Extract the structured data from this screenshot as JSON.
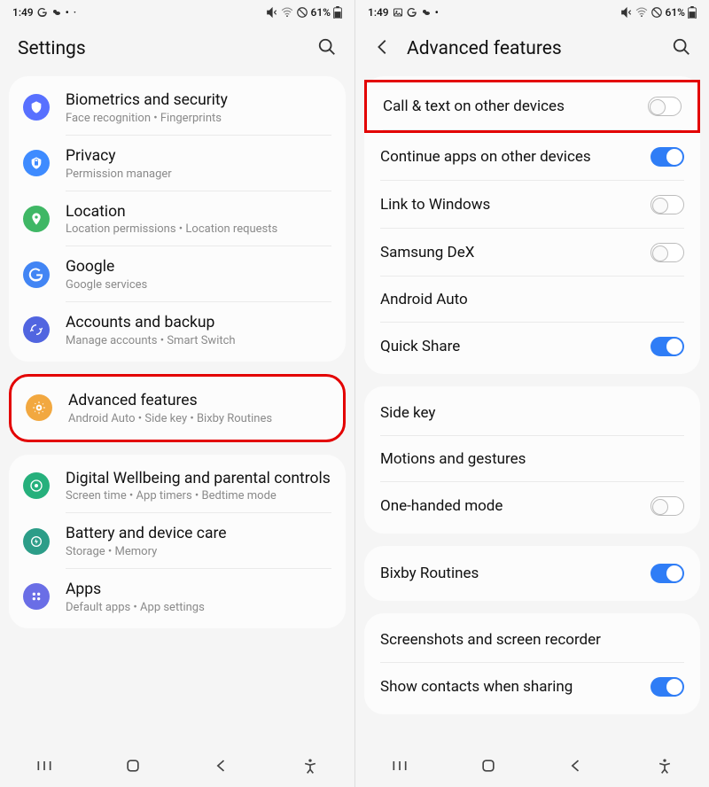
{
  "status": {
    "time": "1:49",
    "battery": "61%"
  },
  "left": {
    "title": "Settings",
    "groups": [
      [
        {
          "key": "biometrics",
          "title": "Biometrics and security",
          "sub": "Face recognition  •  Fingerprints",
          "iconClass": "ic-blue"
        },
        {
          "key": "privacy",
          "title": "Privacy",
          "sub": "Permission manager",
          "iconClass": "ic-lblue"
        },
        {
          "key": "location",
          "title": "Location",
          "sub": "Location permissions  •  Location requests",
          "iconClass": "ic-green"
        },
        {
          "key": "google",
          "title": "Google",
          "sub": "Google services",
          "iconClass": "ic-google"
        },
        {
          "key": "accounts",
          "title": "Accounts and backup",
          "sub": "Manage accounts  •  Smart Switch",
          "iconClass": "ic-dblue"
        }
      ],
      [
        {
          "key": "advanced",
          "title": "Advanced features",
          "sub": "Android Auto  •  Side key  •  Bixby Routines",
          "iconClass": "ic-orange",
          "highlighted": true
        }
      ],
      [
        {
          "key": "wellbeing",
          "title": "Digital Wellbeing and parental controls",
          "sub": "Screen time  •  App timers  •  Bedtime mode",
          "iconClass": "ic-teal"
        },
        {
          "key": "battery",
          "title": "Battery and device care",
          "sub": "Storage  •  Memory",
          "iconClass": "ic-teal2"
        },
        {
          "key": "apps",
          "title": "Apps",
          "sub": "Default apps  •  App settings",
          "iconClass": "ic-purple"
        }
      ]
    ]
  },
  "right": {
    "title": "Advanced features",
    "groups": [
      [
        {
          "key": "calltext",
          "title": "Call & text on other devices",
          "toggle": "off",
          "highlighted": true
        },
        {
          "key": "continueapps",
          "title": "Continue apps on other devices",
          "toggle": "on"
        },
        {
          "key": "linkwindows",
          "title": "Link to Windows",
          "toggle": "off"
        },
        {
          "key": "dex",
          "title": "Samsung DeX",
          "toggle": "off"
        },
        {
          "key": "androidauto",
          "title": "Android Auto"
        },
        {
          "key": "quickshare",
          "title": "Quick Share",
          "toggle": "on"
        }
      ],
      [
        {
          "key": "sidekey",
          "title": "Side key"
        },
        {
          "key": "motions",
          "title": "Motions and gestures"
        },
        {
          "key": "onehanded",
          "title": "One-handed mode",
          "toggle": "off"
        }
      ],
      [
        {
          "key": "bixby",
          "title": "Bixby Routines",
          "toggle": "on"
        }
      ],
      [
        {
          "key": "screenshots",
          "title": "Screenshots and screen recorder"
        },
        {
          "key": "showcontacts",
          "title": "Show contacts when sharing",
          "toggle": "on"
        }
      ]
    ]
  }
}
